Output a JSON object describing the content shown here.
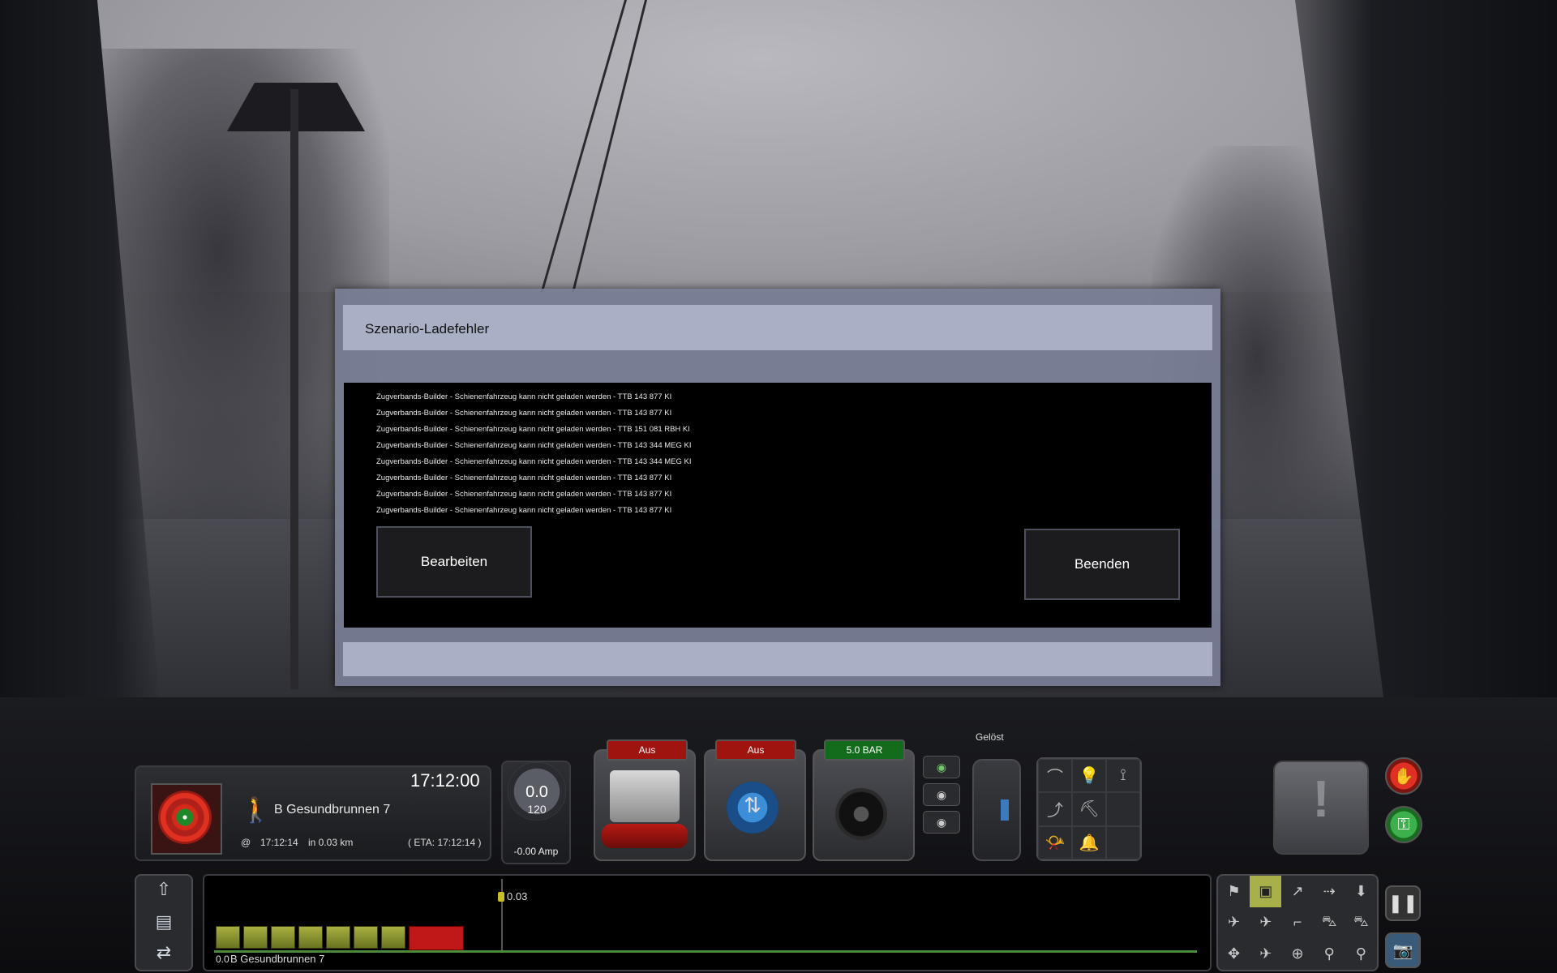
{
  "dialog": {
    "title": "Szenario-Ladefehler",
    "errors": [
      "Zugverbands-Builder - Schienenfahrzeug kann nicht geladen werden - TTB 143 877 KI",
      "Zugverbands-Builder - Schienenfahrzeug kann nicht geladen werden - TTB 143 877 KI",
      "Zugverbands-Builder - Schienenfahrzeug kann nicht geladen werden - TTB 151 081 RBH KI",
      "Zugverbands-Builder - Schienenfahrzeug kann nicht geladen werden - TTB 143 344 MEG KI",
      "Zugverbands-Builder - Schienenfahrzeug kann nicht geladen werden - TTB 143 344 MEG KI",
      "Zugverbands-Builder - Schienenfahrzeug kann nicht geladen werden - TTB 143 877 KI",
      "Zugverbands-Builder - Schienenfahrzeug kann nicht geladen werden - TTB 143 877 KI",
      "Zugverbands-Builder - Schienenfahrzeug kann nicht geladen werden - TTB 143 877 KI"
    ],
    "edit_label": "Bearbeiten",
    "quit_label": "Beenden"
  },
  "hud": {
    "clock": "17:12:00",
    "next_stop": "B Gesundbrunnen 7",
    "at_symbol": "@",
    "next_time": "17:12:14",
    "next_distance": "in 0.03 km",
    "eta": "( ETA:  17:12:14   )",
    "speed": "0.0",
    "speed_limit": "120",
    "amp": "-0.00 Amp",
    "throttle_state": "Aus",
    "reverser_state": "Aus",
    "brake_pressure": "5.0 BAR",
    "brake_status": "Gelöst"
  },
  "track": {
    "marker_distance": "0.03",
    "start_value": "0.0",
    "station": "B Gesundbrunnen 7"
  },
  "icons": {
    "walk": "walk-icon",
    "reverser": "arrows-updown-icon",
    "stop": "hand-stop-icon",
    "key": "key-icon",
    "pause": "pause-icon",
    "camera": "camera-icon"
  },
  "colors": {
    "tag_red": "#a0140f",
    "tag_green": "#136b1c",
    "dialog_bar": "#a9afc4"
  }
}
